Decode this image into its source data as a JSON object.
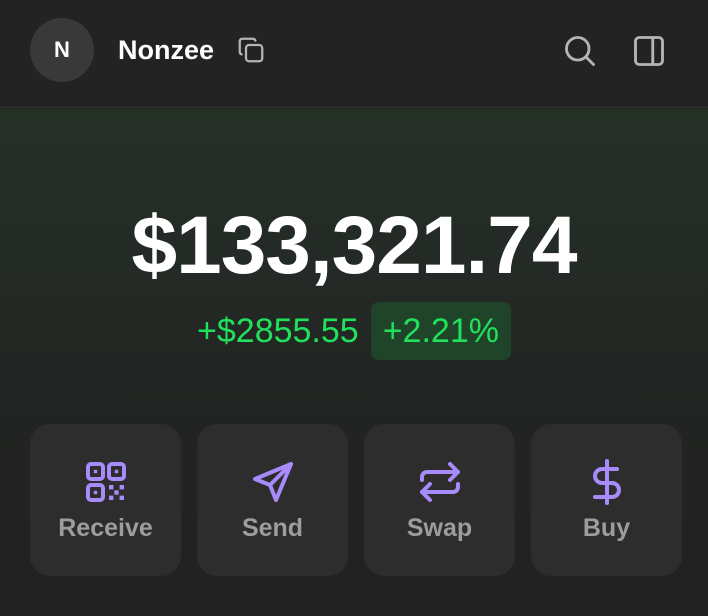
{
  "header": {
    "avatar_initial": "N",
    "account_name": "Nonzee",
    "icons": [
      "copy-icon",
      "search-icon",
      "sidebar-toggle-icon"
    ]
  },
  "portfolio": {
    "balance": "$133,321.74",
    "change_amount": "+$2855.55",
    "change_percent": "+2.21%"
  },
  "actions": [
    {
      "label": "Receive",
      "icon": "qr-code-icon"
    },
    {
      "label": "Send",
      "icon": "send-icon"
    },
    {
      "label": "Swap",
      "icon": "swap-icon"
    },
    {
      "label": "Buy",
      "icon": "dollar-icon"
    }
  ],
  "colors": {
    "accent": "#a78bfa",
    "positive": "#21e05b",
    "positive_badge_bg": "#1f4429",
    "text_primary": "#ffffff",
    "text_muted": "#9d9d9d",
    "button_bg": "#2d2d2d"
  }
}
